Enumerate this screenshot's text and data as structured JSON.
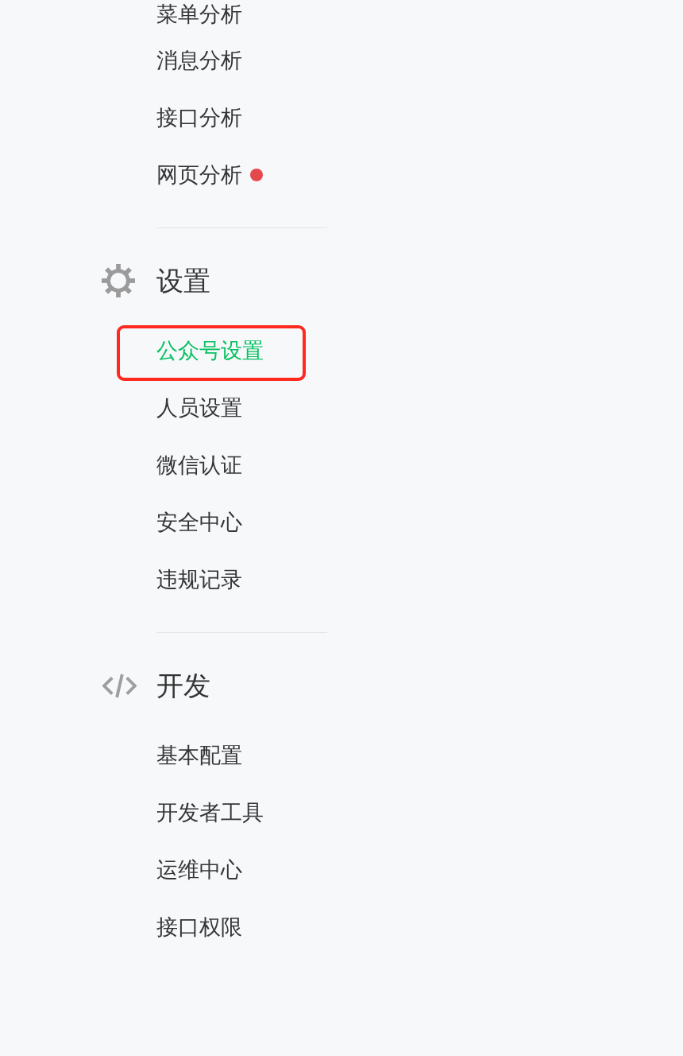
{
  "sections": [
    {
      "items": [
        {
          "label": "菜单分析",
          "selected": false,
          "new": false,
          "highlighted": false
        },
        {
          "label": "消息分析",
          "selected": false,
          "new": false,
          "highlighted": false
        },
        {
          "label": "接口分析",
          "selected": false,
          "new": false,
          "highlighted": false
        },
        {
          "label": "网页分析",
          "selected": false,
          "new": true,
          "highlighted": false
        }
      ]
    },
    {
      "title": "设置",
      "items": [
        {
          "label": "公众号设置",
          "selected": true,
          "new": false,
          "highlighted": true
        },
        {
          "label": "人员设置",
          "selected": false,
          "new": false,
          "highlighted": false
        },
        {
          "label": "微信认证",
          "selected": false,
          "new": false,
          "highlighted": false
        },
        {
          "label": "安全中心",
          "selected": false,
          "new": false,
          "highlighted": false
        },
        {
          "label": "违规记录",
          "selected": false,
          "new": false,
          "highlighted": false
        }
      ]
    },
    {
      "title": "开发",
      "items": [
        {
          "label": "基本配置",
          "selected": false,
          "new": false,
          "highlighted": false
        },
        {
          "label": "开发者工具",
          "selected": false,
          "new": false,
          "highlighted": false
        },
        {
          "label": "运维中心",
          "selected": false,
          "new": false,
          "highlighted": false
        },
        {
          "label": "接口权限",
          "selected": false,
          "new": false,
          "highlighted": false
        }
      ]
    }
  ]
}
